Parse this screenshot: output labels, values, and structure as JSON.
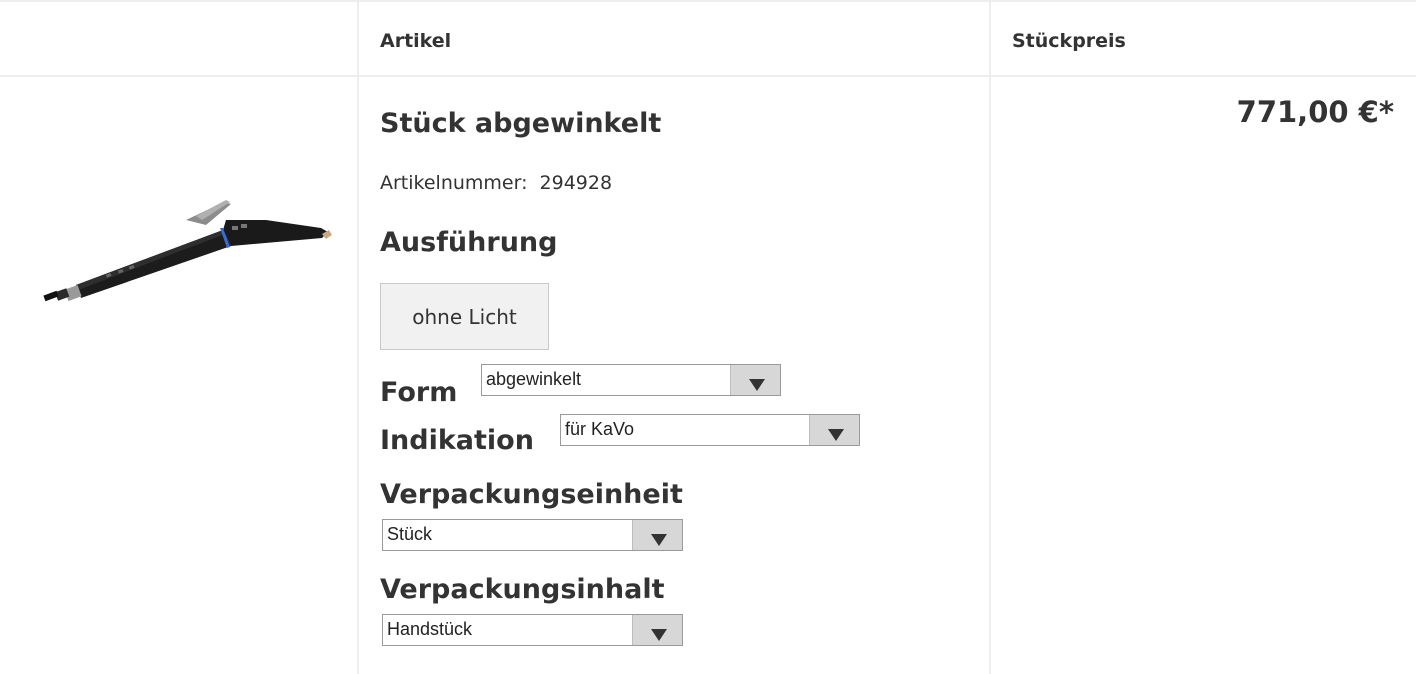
{
  "table": {
    "headers": {
      "image": "",
      "article": "Artikel",
      "unit_price": "Stückpreis"
    }
  },
  "product": {
    "image_icon": "dental-handpiece-image",
    "title": "Stück abgewinkelt",
    "article_number_label": "Artikelnummer:",
    "article_number": "294928",
    "execution_label": "Ausführung",
    "execution_option": "ohne Licht",
    "form_label": "Form",
    "form_value": "abgewinkelt",
    "indication_label": "Indikation",
    "indication_value": "für KaVo",
    "packaging_unit_label": "Verpackungseinheit",
    "packaging_unit_value": "Stück",
    "packaging_content_label": "Verpackungsinhalt",
    "packaging_content_value": "Handstück",
    "price": "771,00 €*"
  },
  "icons": {
    "dropdown_arrow": "triangle-down-icon"
  }
}
